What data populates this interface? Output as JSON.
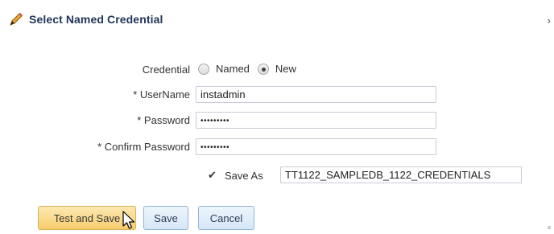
{
  "dialog": {
    "title": "Select Named Credential",
    "close_glyph": "›"
  },
  "form": {
    "credential_label": "Credential",
    "radio_options": [
      {
        "label": "Named",
        "checked": false
      },
      {
        "label": "New",
        "checked": true
      }
    ],
    "username_label": "* UserName",
    "username_value": "instadmin",
    "password_label": "* Password",
    "password_value": "•••••••••",
    "confirm_label": "* Confirm Password",
    "confirm_value": "•••••••••",
    "save_as_check": "✔",
    "save_as_label": "Save As",
    "save_as_value": "TT1122_SAMPLEDB_1122_CREDENTIALS"
  },
  "buttons": {
    "test_and_save": "Test and Save",
    "save": "Save",
    "cancel": "Cancel"
  },
  "colors": {
    "title": "#22365a",
    "primary_button": "#f6cc6c",
    "secondary_button": "#d6e7f7"
  },
  "icons": {
    "title_icon": "pencil-icon",
    "close_icon": "chevron-right-icon",
    "cursor": "mouse-pointer-icon"
  }
}
